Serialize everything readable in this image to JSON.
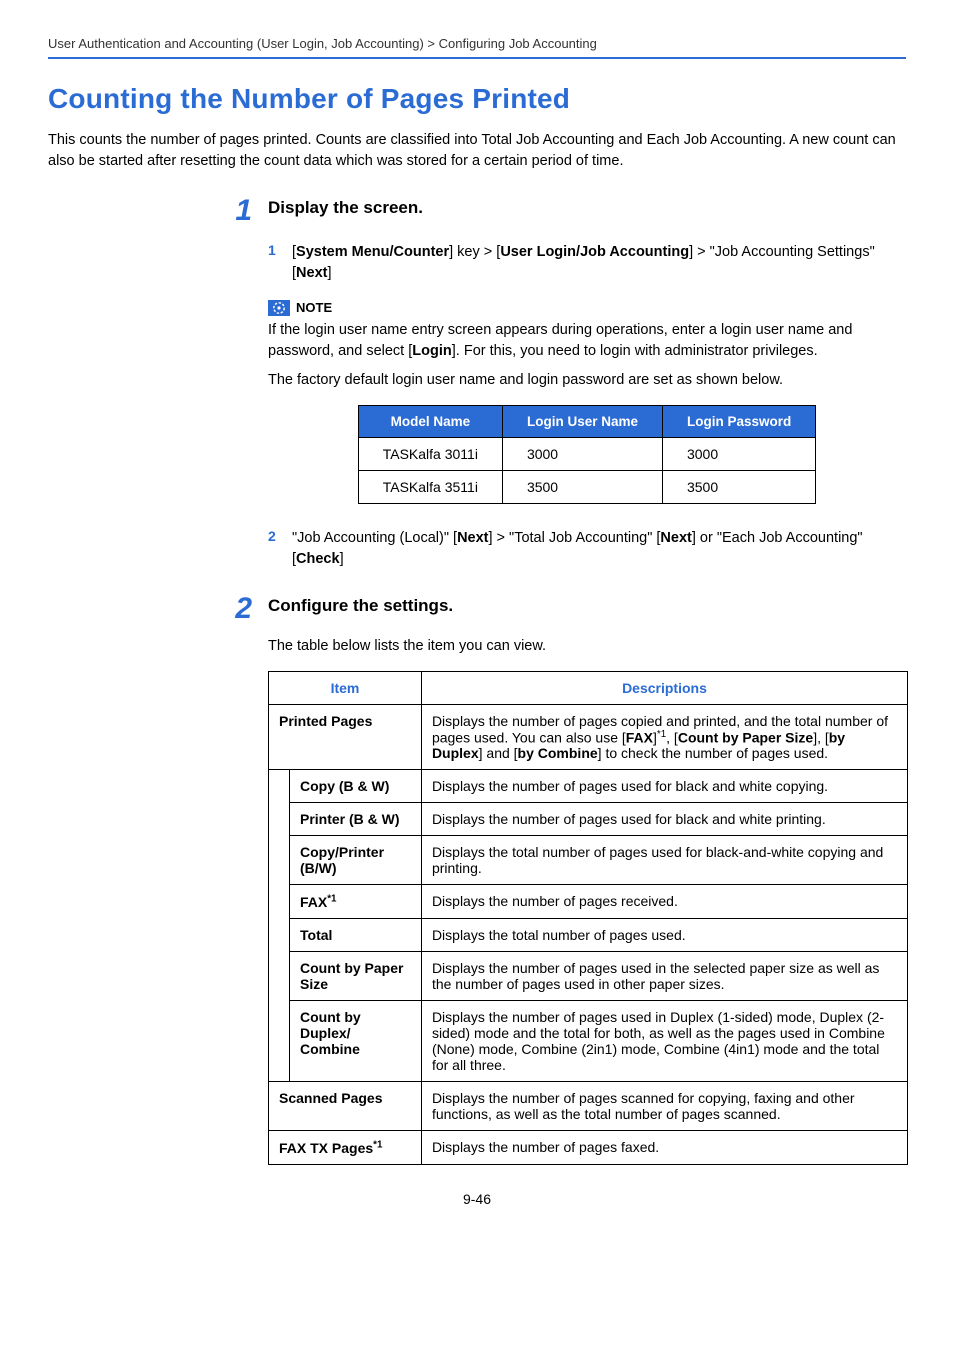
{
  "breadcrumb": "User Authentication and Accounting (User Login, Job Accounting) > Configuring Job Accounting",
  "title": "Counting the Number of Pages Printed",
  "intro": "This counts the number of pages printed. Counts are classified into Total Job Accounting and Each Job Accounting. A new count can also be started after resetting the count data which was stored for a certain period of time.",
  "step1": {
    "num": "1",
    "heading": "Display the screen.",
    "sub1": {
      "num": "1",
      "pre": "[",
      "k1": "System Menu/Counter",
      "mid1": "] key > [",
      "k2": "User Login/Job Accounting",
      "mid2": "] > \"Job Accounting Settings\" [",
      "k3": "Next",
      "post": "]"
    },
    "note_label": "NOTE",
    "note1a": "If the login user name entry screen appears during operations, enter a login user name and password, and select [",
    "note1b": "Login",
    "note1c": "]. For this, you need to login with administrator privileges.",
    "note2": "The factory default login user name and login password are set as shown below.",
    "login_table": {
      "h1": "Model Name",
      "h2": "Login User Name",
      "h3": "Login Password",
      "rows": [
        {
          "model": "TASKalfa 3011i",
          "user": "3000",
          "pass": "3000"
        },
        {
          "model": "TASKalfa 3511i",
          "user": "3500",
          "pass": "3500"
        }
      ]
    },
    "sub2": {
      "num": "2",
      "a": "\"Job Accounting (Local)\" [",
      "b": "Next",
      "c": "] > \"Total Job Accounting\" [",
      "d": "Next",
      "e": "] or \"Each Job Accounting\" [",
      "f": "Check",
      "g": "]"
    }
  },
  "step2": {
    "num": "2",
    "heading": "Configure the settings.",
    "intro": "The table below lists the item you can view.",
    "th_item": "Item",
    "th_desc": "Descriptions",
    "rows": {
      "printed": {
        "label": "Printed Pages",
        "d1": "Displays the number of pages copied and printed, and the total number of pages used. You can also use [",
        "d2": "FAX",
        "d3": "]",
        "d_sup": "*1",
        "d4": ", [",
        "d5": "Count by Paper Size",
        "d6": "], [",
        "d7": "by Duplex",
        "d8": "] and [",
        "d9": "by Combine",
        "d10": "] to check the number of pages used."
      },
      "copy": {
        "label": "Copy (B & W)",
        "desc": "Displays the number of pages used for black and white copying."
      },
      "printer": {
        "label": "Printer (B & W)",
        "desc": "Displays the number of pages used for black and white printing."
      },
      "copyprinter": {
        "label": "Copy/Printer (B/W)",
        "desc": "Displays the total number of pages used for black-and-white copying and printing."
      },
      "fax": {
        "label_a": "FAX",
        "label_sup": "*1",
        "desc": "Displays the number of pages received."
      },
      "total": {
        "label": "Total",
        "desc": "Displays the total number of pages used."
      },
      "papersize": {
        "label": "Count by Paper Size",
        "desc": "Displays the number of pages used in the selected paper size as well as the number of pages used in other paper sizes."
      },
      "duplex": {
        "label": "Count by Duplex/ Combine",
        "desc": "Displays the number of pages used in Duplex (1-sided) mode, Duplex (2-sided) mode and the total for both, as well as the pages used in Combine (None) mode, Combine (2in1) mode, Combine (4in1) mode and the total for all three."
      },
      "scanned": {
        "label": "Scanned Pages",
        "desc": "Displays the number of pages scanned for copying, faxing and other functions, as well as the total number of pages scanned."
      },
      "faxtx": {
        "label_a": "FAX TX Pages",
        "label_sup": "*1",
        "desc": "Displays the number of pages faxed."
      }
    }
  },
  "page_num": "9-46"
}
